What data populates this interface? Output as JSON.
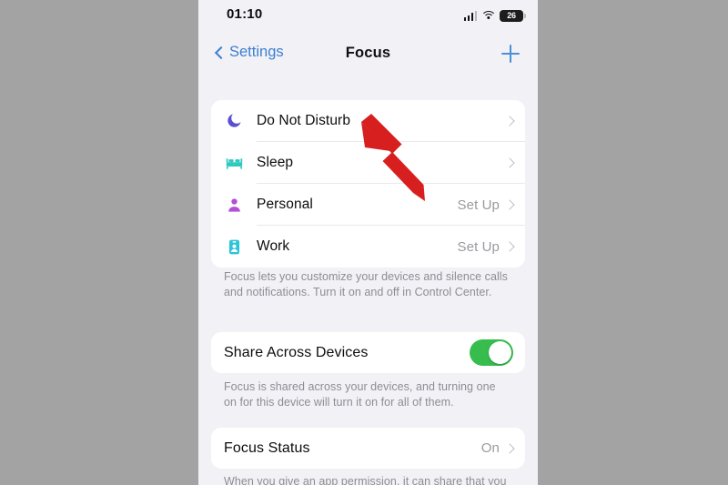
{
  "backdrop_color": "#a3a3a3",
  "screen": {
    "background": "#f1f1f6",
    "card_background": "#ffffff"
  },
  "status_bar": {
    "time": "01:10",
    "cellular_icon": "cellular-bars-icon",
    "wifi_icon": "wifi-icon",
    "battery_icon": "battery-icon",
    "battery_percent": "26"
  },
  "nav": {
    "back_label": "Settings",
    "back_icon": "chevron-left-icon",
    "title": "Focus",
    "add_icon": "plus-icon",
    "accent_color": "#3c7fd0"
  },
  "focus_modes": {
    "items": [
      {
        "label": "Do Not Disturb",
        "value": "",
        "icon": "moon-icon",
        "icon_color": "#5a4fd0"
      },
      {
        "label": "Sleep",
        "value": "",
        "icon": "bed-icon",
        "icon_color": "#2fc9c0"
      },
      {
        "label": "Personal",
        "value": "Set Up",
        "icon": "person-icon",
        "icon_color": "#b44fd8"
      },
      {
        "label": "Work",
        "value": "Set Up",
        "icon": "id-badge-icon",
        "icon_color": "#2cc4d8"
      }
    ],
    "footer": "Focus lets you customize your devices and silence calls and notifications. Turn it on and off in Control Center."
  },
  "share_across_devices": {
    "label": "Share Across Devices",
    "toggle_state": "on",
    "toggle_color": "#36bd4e",
    "footer": "Focus is shared across your devices, and turning one on for this device will turn it on for all of them."
  },
  "focus_status": {
    "label": "Focus Status",
    "value": "On",
    "footer": "When you give an app permission, it can share that you"
  },
  "annotation": {
    "arrow_color": "#d81f1f",
    "points_at": "Do Not Disturb"
  }
}
